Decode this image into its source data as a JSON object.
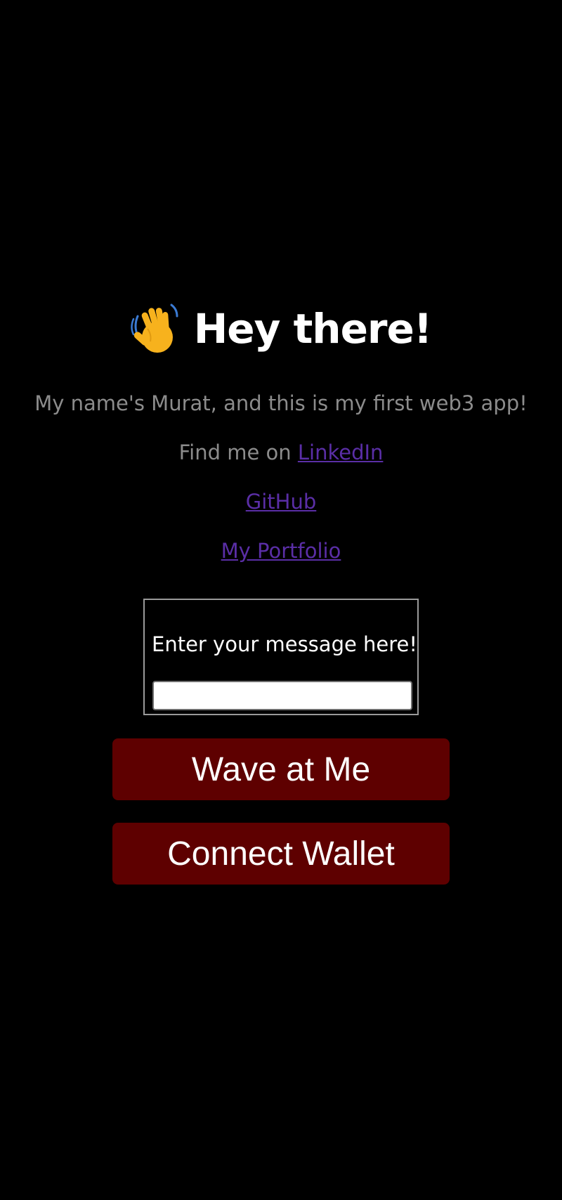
{
  "header": {
    "emoji": "waving-hand-icon",
    "title": "Hey there!"
  },
  "bio": {
    "text": "My name's Murat, and this is my first web3 app!"
  },
  "links": {
    "find_me_prefix": "Find me on ",
    "linkedin": "LinkedIn",
    "github": "GitHub",
    "portfolio": "My Portfolio"
  },
  "message": {
    "label": "Enter your message here!",
    "value": "",
    "placeholder": ""
  },
  "buttons": {
    "wave": "Wave at Me",
    "connect": "Connect Wallet"
  },
  "colors": {
    "background": "#000000",
    "link": "#5a2ea6",
    "button": "#5e0000",
    "muted_text": "#8c8c8c"
  }
}
